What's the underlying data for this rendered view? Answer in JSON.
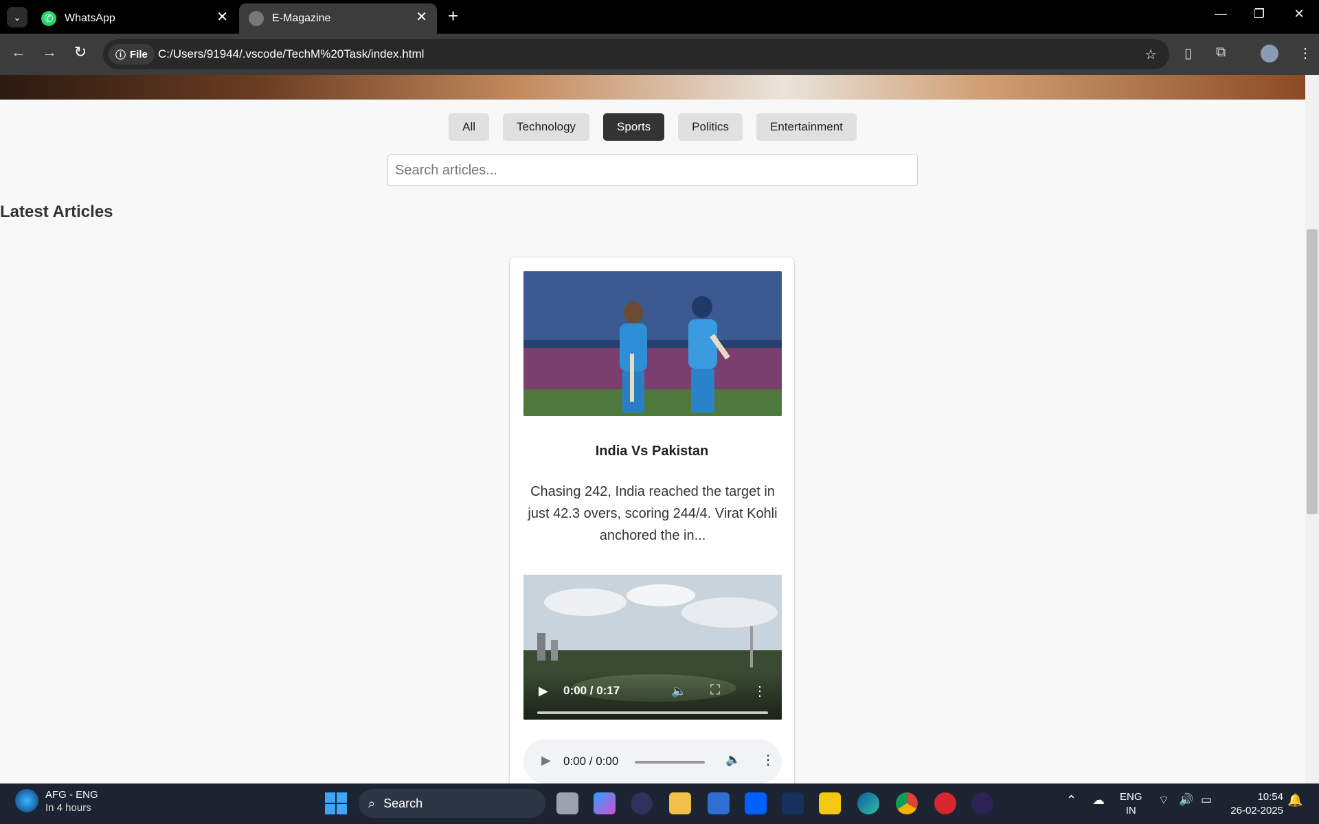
{
  "browser": {
    "tabs": [
      {
        "title": "WhatsApp",
        "icon": "whatsapp-icon"
      },
      {
        "title": "E-Magazine",
        "icon": "globe-icon"
      }
    ],
    "file_chip": "File",
    "url": "C:/Users/91944/.vscode/TechM%20Task/index.html"
  },
  "page": {
    "categories": [
      "All",
      "Technology",
      "Sports",
      "Politics",
      "Entertainment"
    ],
    "active_category": "Sports",
    "search_placeholder": "Search articles...",
    "section_title": "Latest Articles",
    "article": {
      "title": "India Vs Pakistan",
      "description": "Chasing 242, India reached the target in just 42.3 overs, scoring 244/4. Virat Kohli anchored the in...",
      "video_time": "0:00 / 0:17",
      "audio_time": "0:00 / 0:00"
    }
  },
  "taskbar": {
    "weather_title": "AFG - ENG",
    "weather_sub": "In 4 hours",
    "search_label": "Search",
    "lang_top": "ENG",
    "lang_bottom": "IN",
    "time": "10:54",
    "date": "26-02-2025"
  }
}
